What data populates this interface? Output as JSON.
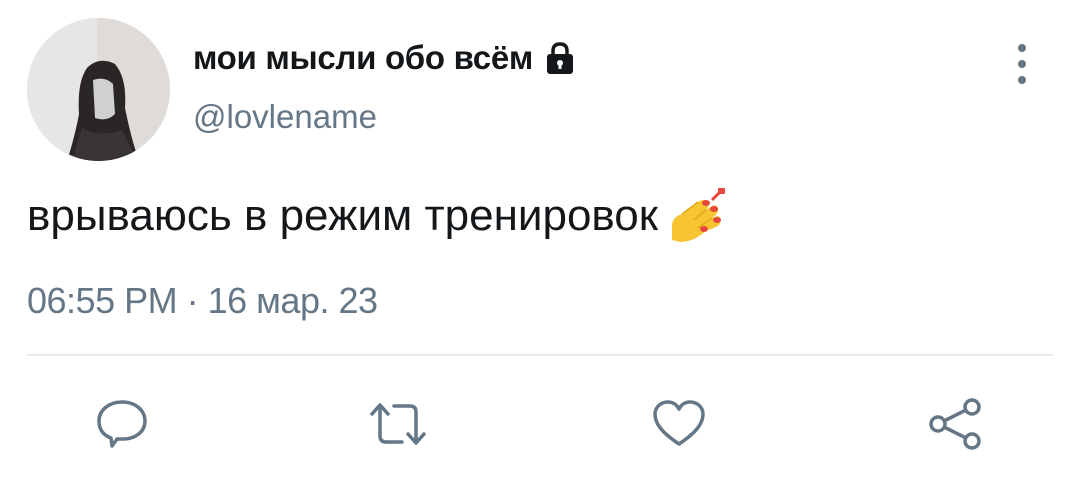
{
  "tweet": {
    "author": {
      "display_name": "мои мысли обо всём",
      "handle": "@lovlename",
      "protected_icon": "lock-icon",
      "avatar": "avatar-photo"
    },
    "text": "врываюсь в режим тренировок",
    "emoji": "nail-polish-emoji",
    "time": "06:55 PM",
    "separator": "·",
    "date": "16 мар. 23"
  },
  "menu": {
    "icon": "more-vertical-icon"
  },
  "actions": [
    {
      "name": "reply",
      "icon": "comment-icon"
    },
    {
      "name": "retweet",
      "icon": "retweet-icon"
    },
    {
      "name": "like",
      "icon": "heart-icon"
    },
    {
      "name": "share",
      "icon": "share-icon"
    }
  ],
  "colors": {
    "text_primary": "#14171a",
    "text_secondary": "#657786",
    "divider": "#e6ecf0",
    "icon": "#657786"
  }
}
